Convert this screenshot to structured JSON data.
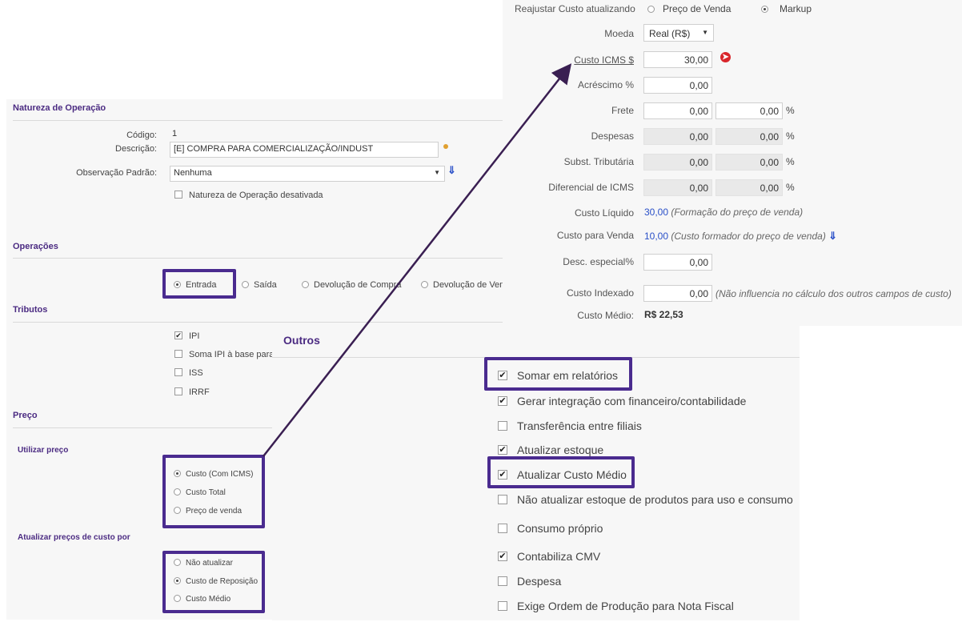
{
  "natureza": {
    "title": "Natureza de Operação",
    "codigo_label": "Código:",
    "codigo_value": "1",
    "descricao_label": "Descrição:",
    "descricao_value": "[E] COMPRA PARA COMERCIALIZAÇÃO/INDUST",
    "obs_label": "Observação Padrão:",
    "obs_value": "Nenhuma",
    "desativada_label": "Natureza de Operação desativada"
  },
  "operacoes": {
    "title": "Operações",
    "options": [
      "Entrada",
      "Saída",
      "Devolução de Compra",
      "Devolução de Venda"
    ]
  },
  "tributos": {
    "title": "Tributos",
    "items": [
      {
        "label": "IPI",
        "checked": true
      },
      {
        "label": "Soma IPI à base para ICM",
        "checked": false
      },
      {
        "label": "ISS",
        "checked": false
      },
      {
        "label": "IRRF",
        "checked": false
      }
    ]
  },
  "preco": {
    "title": "Preço",
    "utilizar_title": "Utilizar preço",
    "utilizar_options": [
      "Custo (Com ICMS)",
      "Custo Total",
      "Preço de venda"
    ],
    "atualizar_title": "Atualizar preços de custo por",
    "atualizar_options": [
      "Não atualizar",
      "Custo de Reposição",
      "Custo Médio"
    ]
  },
  "outros": {
    "title": "Outros",
    "items": [
      {
        "label": "Somar em relatórios",
        "checked": true
      },
      {
        "label": "Gerar integração com financeiro/contabilidade",
        "checked": true
      },
      {
        "label": "Transferência entre filiais",
        "checked": false
      },
      {
        "label": "Atualizar estoque",
        "checked": true
      },
      {
        "label": "Atualizar Custo Médio",
        "checked": true
      },
      {
        "label": "Não atualizar estoque de produtos para uso e consumo",
        "checked": false
      },
      {
        "label": "Consumo próprio",
        "checked": false
      },
      {
        "label": "Contabiliza CMV",
        "checked": true
      },
      {
        "label": "Despesa",
        "checked": false
      },
      {
        "label": "Exige Ordem de Produção para Nota Fiscal",
        "checked": false
      }
    ]
  },
  "custo": {
    "reajustar_label": "Reajustar Custo atualizando",
    "reajustar_opt1": "Preço de Venda",
    "reajustar_opt2": "Markup",
    "moeda_label": "Moeda",
    "moeda_value": "Real (R$)",
    "icms_label": "Custo ICMS $",
    "icms_value": "30,00",
    "acrescimo_label": "Acréscimo %",
    "acrescimo_value": "0,00",
    "frete_label": "Frete",
    "frete_v1": "0,00",
    "frete_v2": "0,00",
    "despesas_label": "Despesas",
    "despesas_v1": "0,00",
    "despesas_v2": "0,00",
    "subst_label": "Subst. Tributária",
    "subst_v1": "0,00",
    "subst_v2": "0,00",
    "difer_label": "Diferencial de ICMS",
    "difer_v1": "0,00",
    "difer_v2": "0,00",
    "pct": "%",
    "liquido_label": "Custo Líquido",
    "liquido_value": "30,00",
    "liquido_note": "(Formação do preço de venda)",
    "venda_label": "Custo para Venda",
    "venda_value": "10,00",
    "venda_note": "(Custo formador do preço de venda)",
    "desc_label": "Desc. especial%",
    "desc_value": "0,00",
    "indexado_label": "Custo Indexado",
    "indexado_value": "0,00",
    "indexado_note": "(Não influencia no cálculo dos outros campos de custo)",
    "medio_label": "Custo Médio:",
    "medio_value": "R$ 22,53"
  },
  "colors": {
    "highlight": "#4a2b8f",
    "section": "#4b2b82",
    "link": "#2a50c8"
  }
}
